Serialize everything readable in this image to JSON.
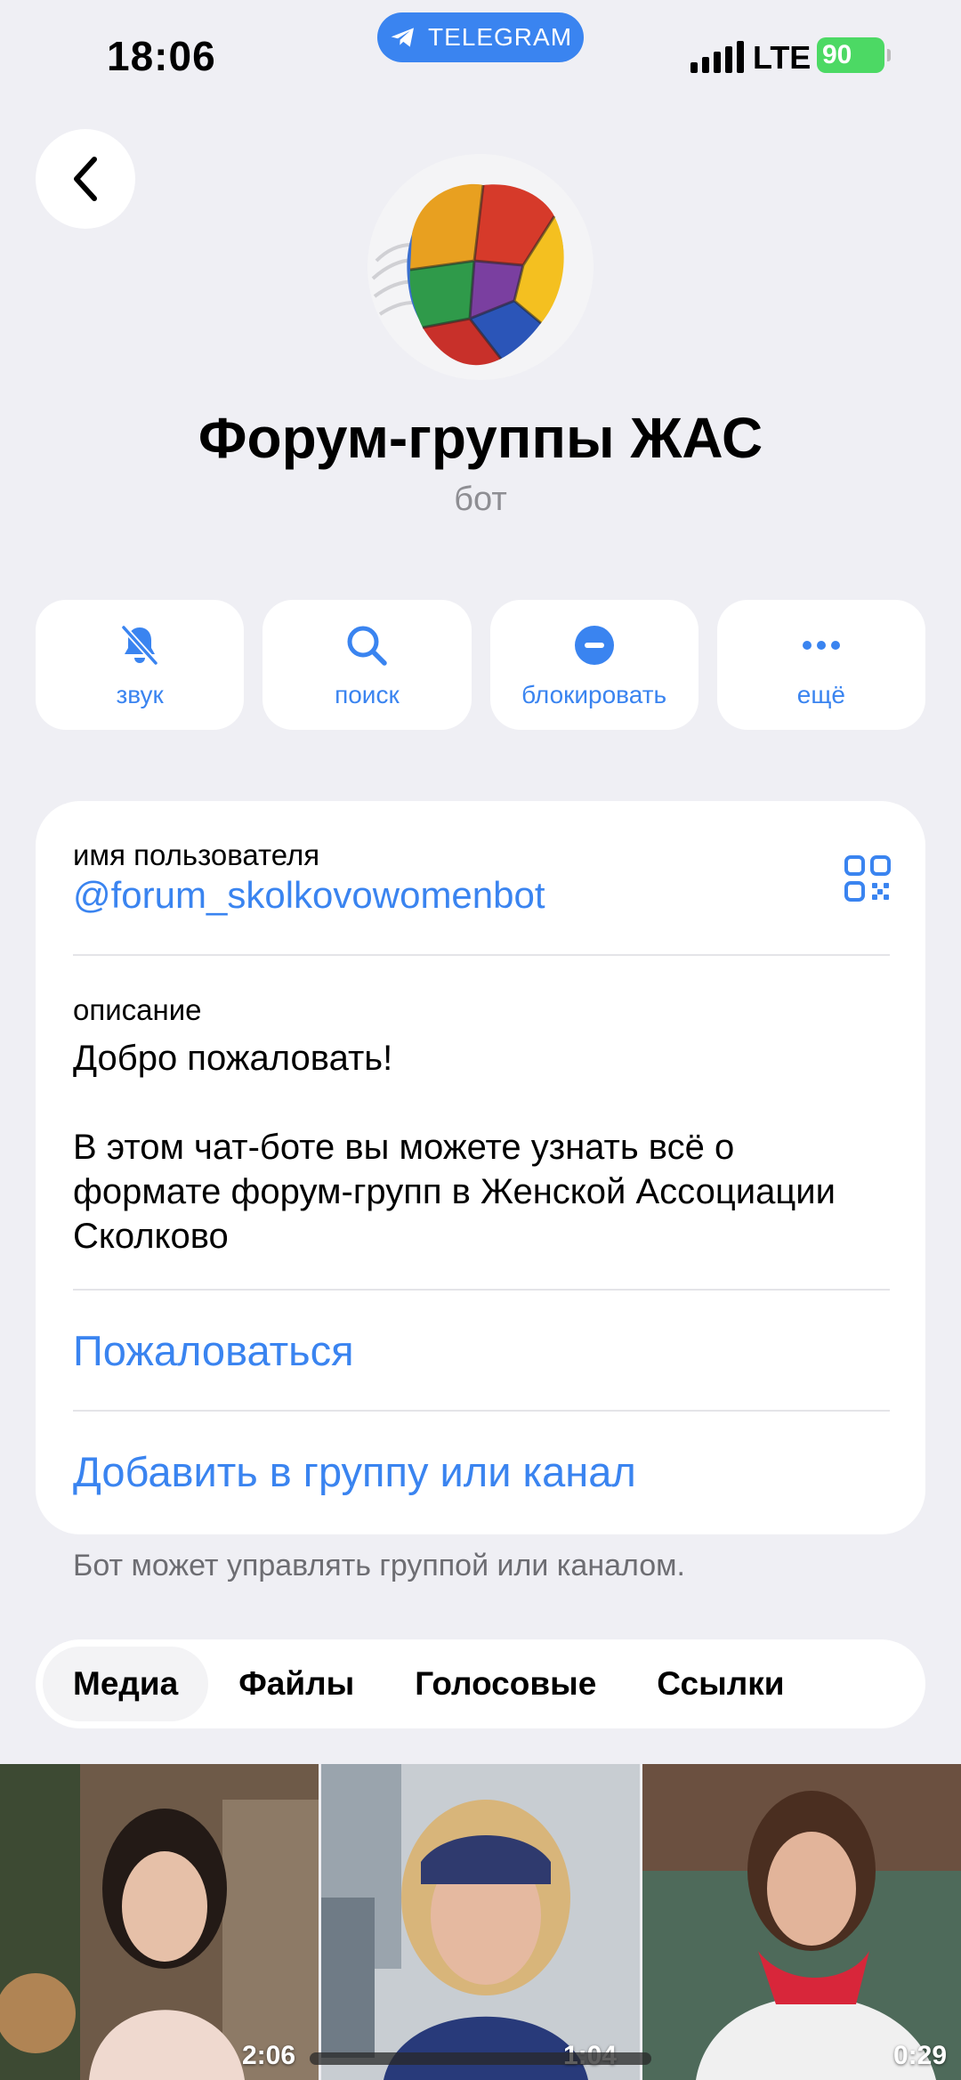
{
  "status_bar": {
    "time": "18:06",
    "app_pill": "TELEGRAM",
    "network": "LTE",
    "battery": "90"
  },
  "profile": {
    "name": "Форум-группы ЖАС",
    "subtitle": "бот"
  },
  "actions": [
    {
      "label": "звук",
      "icon": "bell-slash-icon"
    },
    {
      "label": "поиск",
      "icon": "search-icon"
    },
    {
      "label": "блокировать",
      "icon": "block-icon"
    },
    {
      "label": "ещё",
      "icon": "more-icon"
    }
  ],
  "info": {
    "username_label": "имя пользователя",
    "username": "@forum_skolkovowomenbot",
    "description_label": "описание",
    "description": "Добро пожаловать!\n\nВ этом чат-боте вы можете узнать всё о формате форум-групп в Женской Ассоциации Сколково",
    "report": "Пожаловаться",
    "add_to_group": "Добавить в группу или канал"
  },
  "footnote": "Бот может управлять группой или каналом.",
  "tabs": [
    {
      "label": "Медиа",
      "active": true
    },
    {
      "label": "Файлы",
      "active": false
    },
    {
      "label": "Голосовые",
      "active": false
    },
    {
      "label": "Ссылки",
      "active": false
    }
  ],
  "media": [
    {
      "duration": "2:06"
    },
    {
      "duration": "1:04"
    },
    {
      "duration": "0:29"
    }
  ],
  "colors": {
    "accent": "#3a84f0",
    "background": "#efeff4",
    "battery": "#4cd964"
  }
}
